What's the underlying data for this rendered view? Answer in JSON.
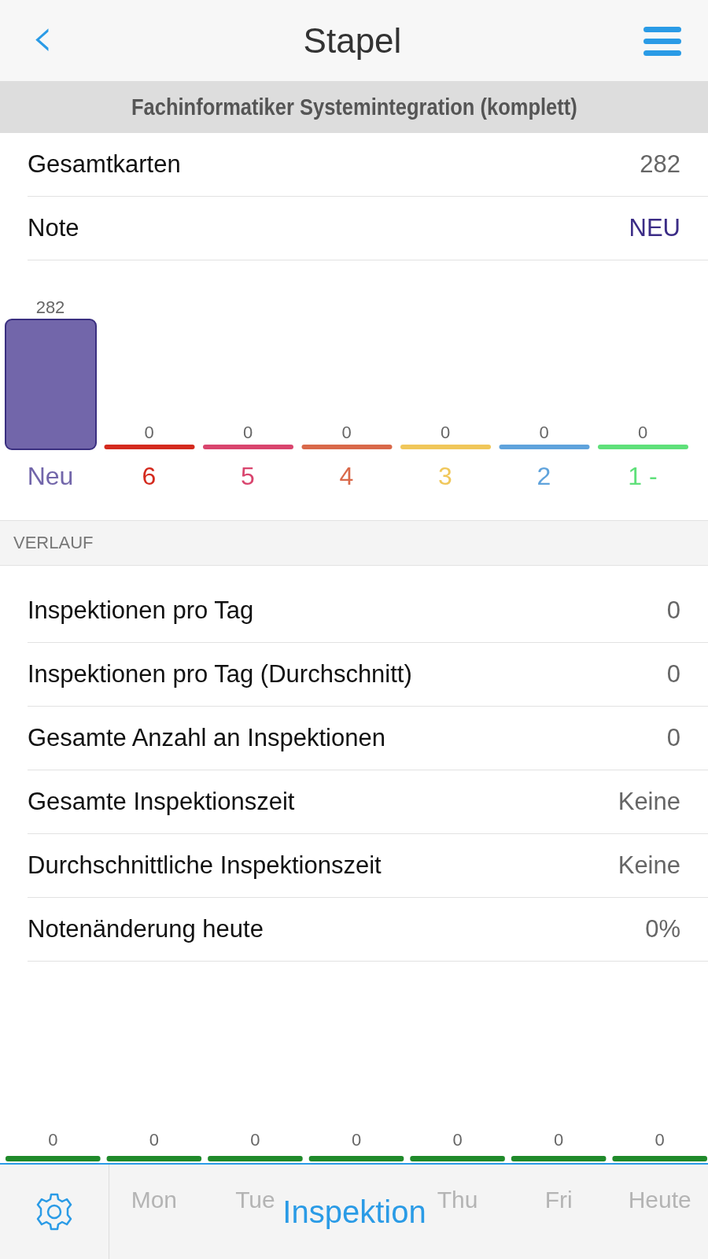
{
  "nav": {
    "back": "‹",
    "title": "Stapel"
  },
  "deck_title": "Fachinformatiker Systemintegration (komplett)",
  "summary": [
    {
      "label": "Gesamtkarten",
      "value": "282",
      "kind": "plain"
    },
    {
      "label": "Note",
      "value": "NEU",
      "kind": "accent"
    }
  ],
  "grades": [
    {
      "label": "Neu",
      "count": "282",
      "color": "#7266aa"
    },
    {
      "label": "6",
      "count": "0",
      "color": "#d42a1e"
    },
    {
      "label": "5",
      "count": "0",
      "color": "#d9456e"
    },
    {
      "label": "4",
      "count": "0",
      "color": "#d9694a"
    },
    {
      "label": "3",
      "count": "0",
      "color": "#f0c75a"
    },
    {
      "label": "2",
      "count": "0",
      "color": "#5fa3dc"
    },
    {
      "label": "1 -",
      "count": "0",
      "color": "#5fe07a"
    }
  ],
  "section": "VERLAUF",
  "stats": [
    {
      "label": "Inspektionen pro Tag",
      "value": "0"
    },
    {
      "label": "Inspektionen pro Tag (Durchschnitt)",
      "value": "0"
    },
    {
      "label": "Gesamte Anzahl an Inspektionen",
      "value": "0"
    },
    {
      "label": "Gesamte Inspektionszeit",
      "value": "Keine"
    },
    {
      "label": "Durchschnittliche Inspektionszeit",
      "value": "Keine"
    },
    {
      "label": "Notenänderung heute",
      "value": "0%"
    }
  ],
  "days": [
    {
      "count": "0"
    },
    {
      "count": "0",
      "label": "Mon"
    },
    {
      "count": "0",
      "label": "Tue"
    },
    {
      "count": "0"
    },
    {
      "count": "0",
      "label": "Thu"
    },
    {
      "count": "0",
      "label": "Fri"
    },
    {
      "count": "0",
      "label": "Heute"
    }
  ],
  "bottom_bar": {
    "action": "Inspektion"
  }
}
